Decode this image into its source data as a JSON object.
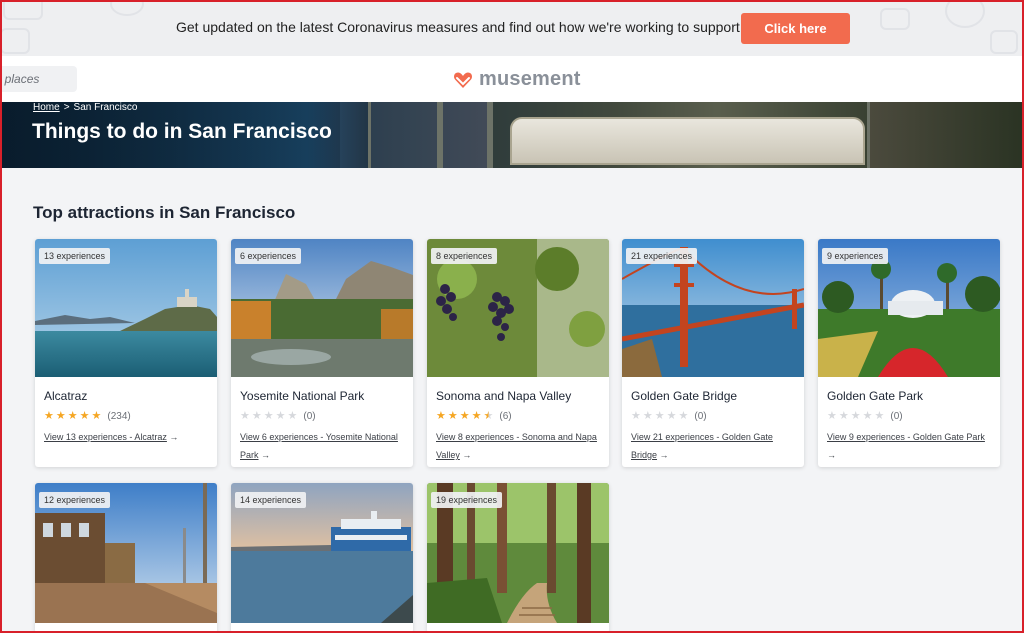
{
  "banner": {
    "message": "Get updated on the latest Coronavirus measures and find out how we're working to support you.",
    "button_label": "Click here"
  },
  "header": {
    "search_placeholder": "Find places",
    "logo_text": "musement"
  },
  "hero": {
    "breadcrumb_home": "Home",
    "breadcrumb_separator": ">",
    "breadcrumb_current": "San Francisco",
    "title": "Things to do in San Francisco"
  },
  "section": {
    "title": "Top attractions in San Francisco"
  },
  "cards": [
    {
      "badge": "13 experiences",
      "name": "Alcatraz",
      "rating": 5,
      "reviews": "(234)",
      "link": "View 13 experiences - Alcatraz",
      "arrow": "→"
    },
    {
      "badge": "6 experiences",
      "name": "Yosemite National Park",
      "rating": 0,
      "reviews": "(0)",
      "link": "View 6 experiences - Yosemite National Park",
      "arrow": "→"
    },
    {
      "badge": "8 experiences",
      "name": "Sonoma and Napa Valley",
      "rating": 4.5,
      "reviews": "(6)",
      "link": "View 8 experiences - Sonoma and Napa Valley",
      "arrow": "→"
    },
    {
      "badge": "21 experiences",
      "name": "Golden Gate Bridge",
      "rating": 0,
      "reviews": "(0)",
      "link": "View 21 experiences - Golden Gate Bridge",
      "arrow": "→"
    },
    {
      "badge": "9 experiences",
      "name": "Golden Gate Park",
      "rating": 0,
      "reviews": "(0)",
      "link": "View 9 experiences - Golden Gate Park",
      "arrow": "→"
    },
    {
      "badge": "12 experiences"
    },
    {
      "badge": "14 experiences"
    },
    {
      "badge": "19 experiences"
    }
  ],
  "colors": {
    "accent": "#f26b4e",
    "star": "#f5a623",
    "logo_heart": "#f26b4e"
  }
}
